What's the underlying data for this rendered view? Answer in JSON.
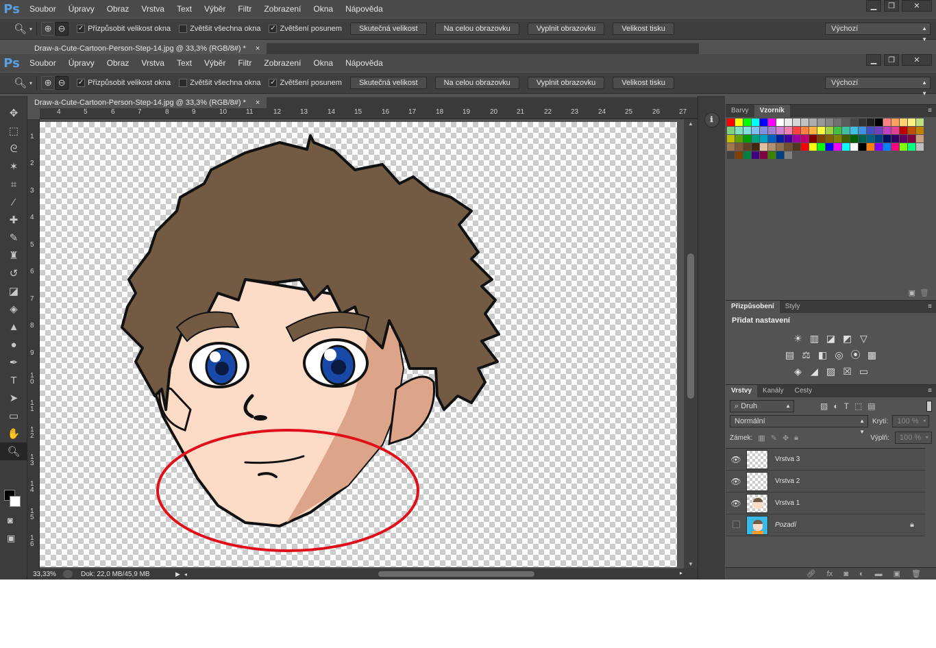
{
  "app": {
    "logo": "Ps",
    "menu": [
      "Soubor",
      "Úpravy",
      "Obraz",
      "Vrstva",
      "Text",
      "Výběr",
      "Filtr",
      "Zobrazení",
      "Okna",
      "Nápověda"
    ],
    "window_buttons": {
      "minimize": "▁",
      "restore": "❐",
      "close": "✕"
    }
  },
  "options": {
    "checks": [
      {
        "label": "Přizpůsobit velikost okna",
        "checked": true
      },
      {
        "label": "Zvětšit všechna okna",
        "checked": false
      },
      {
        "label": "Zvětšení posunem",
        "checked": true
      }
    ],
    "buttons": [
      "Skutečná velikost",
      "Na celou obrazovku",
      "Vyplnit obrazovku",
      "Velikost tisku"
    ],
    "preset": "Výchozí"
  },
  "document": {
    "tab_title": "Draw-a-Cute-Cartoon-Person-Step-14.jpg @ 33,3% (RGB/8#) *",
    "tab_close": "×"
  },
  "ruler": {
    "top": [
      "4",
      "5",
      "6",
      "7",
      "8",
      "9",
      "10",
      "11",
      "12",
      "13",
      "14",
      "15",
      "16",
      "17",
      "18",
      "19",
      "20",
      "21",
      "22",
      "23",
      "24",
      "25",
      "26",
      "27"
    ],
    "left": [
      "1",
      "2",
      "3",
      "4",
      "5",
      "6",
      "7",
      "8",
      "9",
      "1\n0",
      "1\n1",
      "1\n2",
      "1\n3",
      "1\n4",
      "1\n5",
      "1\n6"
    ]
  },
  "status": {
    "zoom": "33,33%",
    "doc": "Dok: 22,0 MB/45,9 MB"
  },
  "swatches_panel": {
    "tabs": [
      "Barvy",
      "Vzorník"
    ],
    "active": "Vzorník",
    "colors": [
      "#ff0000",
      "#ffff00",
      "#00ff00",
      "#00ffff",
      "#0000ff",
      "#ff00ff",
      "#ffffff",
      "#ebebeb",
      "#d6d6d6",
      "#c2c2c2",
      "#adadad",
      "#999999",
      "#858585",
      "#707070",
      "#5c5c5c",
      "#474747",
      "#333333",
      "#1f1f1f",
      "#000000",
      "#ff8080",
      "#ffa060",
      "#ffd070",
      "#fff080",
      "#c0e080",
      "#80d080",
      "#80e0c0",
      "#80e0e0",
      "#80c0f0",
      "#8090e0",
      "#a080d0",
      "#d080d0",
      "#f080b0",
      "#ff4040",
      "#ff8040",
      "#ffb040",
      "#ffff40",
      "#a0d040",
      "#40c040",
      "#40c0a0",
      "#40c0e0",
      "#4090e0",
      "#4050c0",
      "#7040c0",
      "#c040c0",
      "#e04090",
      "#c00000",
      "#c05000",
      "#c08000",
      "#c0c000",
      "#60a000",
      "#00a000",
      "#00a080",
      "#00a0c0",
      "#0060c0",
      "#0020a0",
      "#4000a0",
      "#a000a0",
      "#c00070",
      "#800000",
      "#804000",
      "#806000",
      "#808000",
      "#406000",
      "#006000",
      "#006050",
      "#006080",
      "#004080",
      "#001060",
      "#300060",
      "#600060",
      "#800040",
      "#c8a080",
      "#a07850",
      "#805838",
      "#604020",
      "#402810",
      "#e0c0a0",
      "#b09070",
      "#907050",
      "#705030",
      "#503820",
      "#ff0000",
      "#ffff00",
      "#00ff00",
      "#0000ff",
      "#ff00ff",
      "#00ffff",
      "#ffffff",
      "#000000",
      "#ff8000",
      "#8000ff",
      "#0080ff",
      "#ff0080",
      "#80ff00",
      "#00ff80",
      "#c0c0c0",
      "#404040",
      "#804000",
      "#008040",
      "#400080",
      "#800040",
      "#408000",
      "#004080",
      "#808080"
    ]
  },
  "adjustments_panel": {
    "tabs": [
      "Přizpůsobení",
      "Styly"
    ],
    "active": "Přizpůsobení",
    "title": "Přidat nastavení",
    "rows": [
      [
        "☀",
        "▥",
        "◪",
        "◩",
        "▽"
      ],
      [
        "▤",
        "⚖",
        "◧",
        "◎",
        "⦿",
        "▦"
      ],
      [
        "◈",
        "◢",
        "▨",
        "☒",
        "▭"
      ]
    ]
  },
  "layers_panel": {
    "tabs": [
      "Vrstvy",
      "Kanály",
      "Cesty"
    ],
    "active": "Vrstvy",
    "filter": "Druh",
    "blend": "Normální",
    "opacity_label": "Krytí:",
    "opacity": "100 %",
    "lock_label": "Zámek:",
    "fill_label": "Výplň:",
    "fill": "100 %",
    "layers": [
      {
        "name": "Vrstva 3",
        "visible": true,
        "kind": "empty"
      },
      {
        "name": "Vrstva 2",
        "visible": true,
        "kind": "empty"
      },
      {
        "name": "Vrstva 1",
        "visible": true,
        "kind": "head"
      },
      {
        "name": "Pozadí",
        "visible": false,
        "kind": "bg",
        "locked": true
      }
    ]
  }
}
